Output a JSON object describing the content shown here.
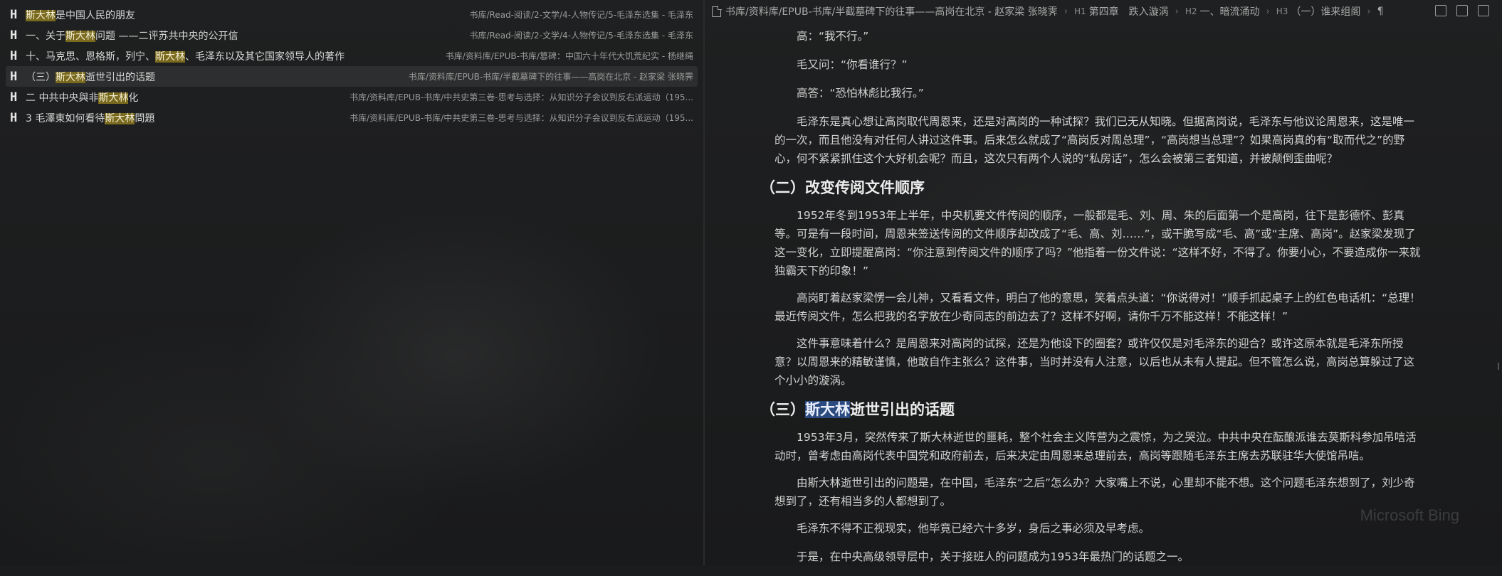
{
  "search_results": [
    {
      "pre": "",
      "hl": "斯大林",
      "post": "是中国人民的朋友",
      "path": "书库/Read-阅读/2-文学/4-人物传记/5-毛泽东选集 - 毛泽东",
      "active": false
    },
    {
      "pre": "一、关于",
      "hl": "斯大林",
      "post": "问题 ——二评苏共中央的公开信",
      "path": "书库/Read-阅读/2-文学/4-人物传记/5-毛泽东选集 - 毛泽东",
      "active": false
    },
    {
      "pre": "十、马克思、恩格斯，列宁、",
      "hl": "斯大林",
      "post": "、毛泽东以及其它国家领导人的著作",
      "path": "书库/资料库/EPUB-书库/篡碑：中国六十年代大饥荒纪实 - 杨继绳",
      "active": false
    },
    {
      "pre": "（三）",
      "hl": "斯大林",
      "post": "逝世引出的话题",
      "path": "书库/资料库/EPUB-书库/半截墓碑下的往事——高岗在北京 - 赵家梁 张晓霁",
      "active": true
    },
    {
      "pre": "二 中共中央與非",
      "hl": "斯大林",
      "post": "化",
      "path": "书库/资料库/EPUB-书库/中共史第三卷-思考与选择：从知识分子会议到反右派运动（195...",
      "active": false
    },
    {
      "pre": "3 毛澤東如何看待",
      "hl": "斯大林",
      "post": "問題",
      "path": "书库/资料库/EPUB-书库/中共史第三卷-思考与选择：从知识分子会议到反右派运动（195...",
      "active": false
    }
  ],
  "breadcrumb": {
    "file": "书库/资料库/EPUB-书库/半截墓碑下的往事——高岗在北京 - 赵家梁 张晓霁",
    "h1_tag": "H1",
    "h1": "第四章　跌入漩涡",
    "h2_tag": "H2",
    "h2": "一、暗流涌动",
    "h3_tag": "H3",
    "h3": "（一）谁来组阁",
    "end": "¶"
  },
  "document": {
    "p1": "高：“我不行。”",
    "p2": "毛又问：“你看谁行？”",
    "p3": "高答：“恐怕林彪比我行。”",
    "p4": "毛泽东是真心想让高岗取代周恩来，还是对高岗的一种试探？我们已无从知晓。但据高岗说，毛泽东与他议论周恩来，这是唯一的一次，而且他没有对任何人讲过这件事。后来怎么就成了“高岗反对周总理”，“高岗想当总理”？如果高岗真的有“取而代之”的野心，何不紧紧抓住这个大好机会呢？而且，这次只有两个人说的“私房话”，怎么会被第三者知道，并被颠倒歪曲呢？",
    "h_b": "（二）改变传阅文件顺序",
    "p5": "1952年冬到1953年上半年，中央机要文件传阅的顺序，一般都是毛、刘、周、朱的后面第一个是高岗，往下是彭德怀、彭真等。可是有一段时间，周恩来签送传阅的文件顺序却改成了“毛、高、刘……”，或干脆写成“毛、高”或“主席、高岗”。赵家梁发现了这一变化，立即提醒高岗：“你注意到传阅文件的顺序了吗？”他指着一份文件说：“这样不好，不得了。你要小心，不要造成你一来就独霸天下的印象！”",
    "p6": "高岗盯着赵家梁愣一会儿神，又看看文件，明白了他的意思，笑着点头道：“你说得对！”顺手抓起桌子上的红色电话机：“总理！最近传阅文件，怎么把我的名字放在少奇同志的前边去了？这样不好啊，请你千万不能这样！不能这样！”",
    "p7": "这件事意味着什么？是周恩来对高岗的试探，还是为他设下的圈套？或许仅仅是对毛泽东的迎合？或许这原本就是毛泽东所授意？以周恩来的精敏谨慎，他敢自作主张么？这件事，当时并没有人注意，以后也从未有人提起。但不管怎么说，高岗总算躲过了这个小小的漩涡。",
    "h_c_pre": "（三）",
    "h_c_sel": "斯大林",
    "h_c_post": "逝世引出的话题",
    "p8": "1953年3月，突然传来了斯大林逝世的噩耗，整个社会主义阵营为之震惊，为之哭泣。中共中央在酝酿派谁去莫斯科参加吊唁活动时，曾考虑由高岗代表中国党和政府前去，后来决定由周恩来总理前去，高岗等跟随毛泽东主席去苏联驻华大使馆吊唁。",
    "p9": "由斯大林逝世引出的问题是，在中国，毛泽东“之后”怎么办？大家嘴上不说，心里却不能不想。这个问题毛泽东想到了，刘少奇想到了，还有相当多的人都想到了。",
    "p10": "毛泽东不得不正视现实，他毕竟已经六十多岁，身后之事必须及早考虑。",
    "p11": "于是，在中央高级领导层中，关于接班人的问题成为1953年最热门的话题之一。"
  },
  "watermark": "Microsoft Bing"
}
